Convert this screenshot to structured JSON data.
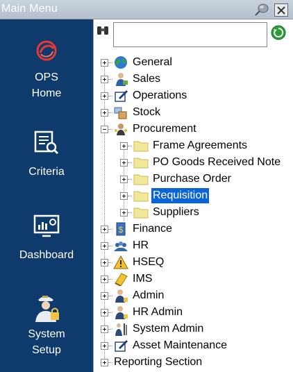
{
  "window": {
    "title": "Main Menu"
  },
  "colors": {
    "nav_bg": "#0e3a6c",
    "selection": "#0a64d8",
    "folder": "#f3e89a"
  },
  "nav": {
    "ops_home": "OPS\nHome",
    "criteria": "Criteria",
    "dashboard": "Dashboard",
    "system_setup": "System\nSetup"
  },
  "search": {
    "value": "",
    "placeholder": ""
  },
  "tree": {
    "general": "General",
    "sales": "Sales",
    "operations": "Operations",
    "stock": "Stock",
    "procurement": "Procurement",
    "procurement_children": {
      "frame_agreements": "Frame Agreements",
      "po_goods_received_note": "PO Goods Received Note",
      "purchase_order": "Purchase Order",
      "requisition": "Requisition",
      "suppliers": "Suppliers"
    },
    "finance": "Finance",
    "hr": "HR",
    "hseq": "HSEQ",
    "ims": "IMS",
    "admin": "Admin",
    "hr_admin": "HR Admin",
    "system_admin": "System Admin",
    "asset_maintenance": "Asset Maintenance",
    "reporting_section": "Reporting Section",
    "selected": "Requisition"
  }
}
